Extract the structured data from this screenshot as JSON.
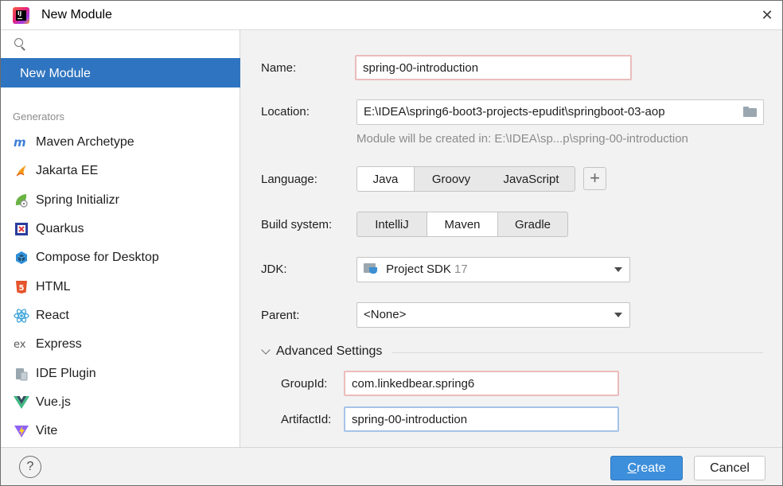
{
  "window": {
    "title": "New Module"
  },
  "sidebar": {
    "selected": "New Module",
    "section_label": "Generators",
    "items": [
      {
        "label": "Maven Archetype",
        "icon": "maven-icon"
      },
      {
        "label": "Jakarta EE",
        "icon": "jakarta-icon"
      },
      {
        "label": "Spring Initializr",
        "icon": "spring-icon"
      },
      {
        "label": "Quarkus",
        "icon": "quarkus-icon"
      },
      {
        "label": "Compose for Desktop",
        "icon": "compose-icon"
      },
      {
        "label": "HTML",
        "icon": "html5-icon"
      },
      {
        "label": "React",
        "icon": "react-icon"
      },
      {
        "label": "Express",
        "icon": "express-icon"
      },
      {
        "label": "IDE Plugin",
        "icon": "ide-plugin-icon"
      },
      {
        "label": "Vue.js",
        "icon": "vue-icon"
      },
      {
        "label": "Vite",
        "icon": "vite-icon"
      }
    ]
  },
  "form": {
    "name_label": "Name:",
    "name_value": "spring-00-introduction",
    "location_label": "Location:",
    "location_value": "E:\\IDEA\\spring6-boot3-projects-epudit\\springboot-03-aop",
    "location_hint": "Module will be created in: E:\\IDEA\\sp...p\\spring-00-introduction",
    "language_label": "Language:",
    "language_options": [
      "Java",
      "Groovy",
      "JavaScript"
    ],
    "language_selected": "Java",
    "language_add": "+",
    "build_label": "Build system:",
    "build_options": [
      "IntelliJ",
      "Maven",
      "Gradle"
    ],
    "build_selected": "Maven",
    "jdk_label": "JDK:",
    "jdk_value": "Project SDK",
    "jdk_version": "17",
    "parent_label": "Parent:",
    "parent_value": "<None>",
    "advanced_label": "Advanced Settings",
    "groupid_label": "GroupId:",
    "groupid_value": "com.linkedbear.spring6",
    "artifactid_label": "ArtifactId:",
    "artifactid_value": "spring-00-introduction"
  },
  "footer": {
    "help": "?",
    "create_mnemonic": "C",
    "create_rest": "reate",
    "cancel": "Cancel"
  },
  "colors": {
    "selection": "#2f74c0",
    "primary_button": "#3d8fdb",
    "error_border": "#ebbcbc",
    "focus_border": "#a5c3e8"
  }
}
